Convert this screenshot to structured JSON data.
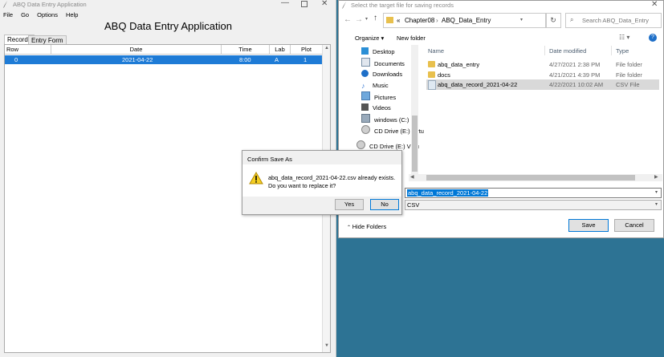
{
  "app": {
    "title": "ABQ Data Entry Application",
    "heading": "ABQ Data Entry Application",
    "menu": [
      "File",
      "Go",
      "Options",
      "Help"
    ],
    "tabs": [
      "Records",
      "Entry Form"
    ],
    "columns": [
      "Row",
      "Date",
      "Time",
      "Lab",
      "Plot"
    ],
    "rows": [
      {
        "row": "0",
        "date": "2021-04-22",
        "time": "8:00",
        "lab": "A",
        "plot": "1"
      }
    ]
  },
  "file_dialog": {
    "title": "Select the target file for saving records",
    "breadcrumb": [
      "«",
      "Chapter08",
      "ABQ_Data_Entry"
    ],
    "search_placeholder": "Search ABQ_Data_Entry",
    "toolbar": {
      "organize": "Organize ▾",
      "new_folder": "New folder"
    },
    "nav": [
      {
        "label": "Desktop",
        "icon": "desktop-icon"
      },
      {
        "label": "Documents",
        "icon": "documents-icon"
      },
      {
        "label": "Downloads",
        "icon": "downloads-icon"
      },
      {
        "label": "Music",
        "icon": "music-icon"
      },
      {
        "label": "Pictures",
        "icon": "pictures-icon"
      },
      {
        "label": "Videos",
        "icon": "videos-icon"
      },
      {
        "label": "windows (C:)",
        "icon": "drive-icon"
      },
      {
        "label": "CD Drive (E:) Virtu",
        "icon": "cd-drive-icon"
      },
      {
        "label": "CD Drive (E:) Virtu",
        "icon": "cd-drive-icon"
      }
    ],
    "columns": {
      "name": "Name",
      "date": "Date modified",
      "type": "Type"
    },
    "files": [
      {
        "name": "abq_data_entry",
        "date": "4/27/2021 2:38 PM",
        "type": "File folder",
        "kind": "folder"
      },
      {
        "name": "docs",
        "date": "4/21/2021 4:39 PM",
        "type": "File folder",
        "kind": "folder"
      },
      {
        "name": "abq_data_record_2021-04-22",
        "date": "4/22/2021 10:02 AM",
        "type": "CSV File",
        "kind": "csv"
      }
    ],
    "filename_value": "abq_data_record_2021-04-22",
    "filetype_value": "CSV",
    "hide_folders": "Hide Folders",
    "save": "Save",
    "cancel": "Cancel"
  },
  "confirm": {
    "title": "Confirm Save As",
    "line1": "abq_data_record_2021-04-22.csv already exists.",
    "line2": "Do you want to replace it?",
    "yes": "Yes",
    "no": "No"
  },
  "colors": {
    "selection": "#1e7bd6",
    "desktop": "#2d7394",
    "accent": "#0078d7"
  }
}
